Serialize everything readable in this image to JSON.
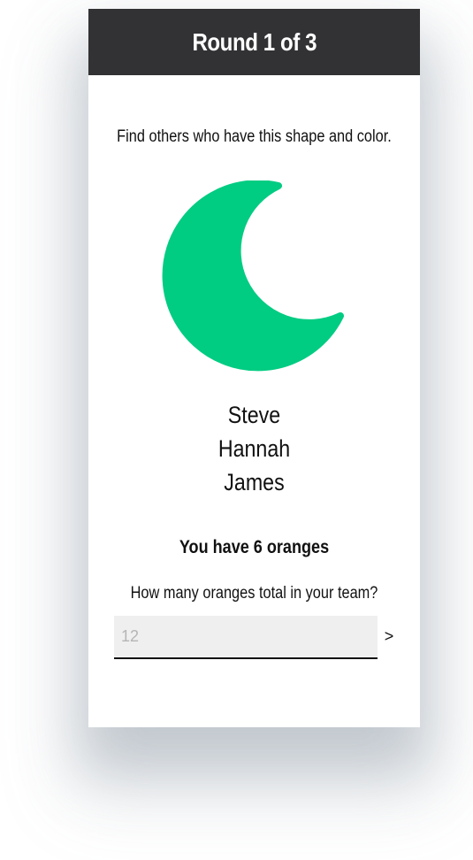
{
  "header": {
    "title": "Round 1 of 3",
    "background_color": "#323134"
  },
  "instruction": "Find others who have this shape and color.",
  "shape": {
    "icon": "crescent-moon-icon",
    "color": "#00CC82"
  },
  "team_names": [
    "Steve",
    "Hannah",
    "James"
  ],
  "oranges_status": "You have 6 oranges",
  "question": "How many oranges total in your team?",
  "answer": {
    "value": "",
    "placeholder": "12"
  },
  "submit_label": ">"
}
